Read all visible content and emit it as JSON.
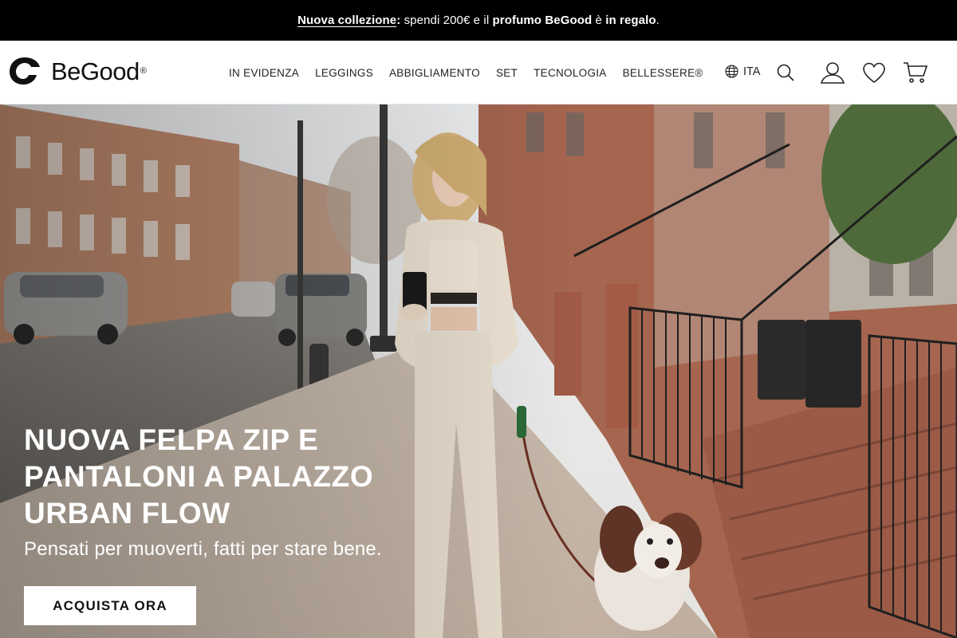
{
  "announcement": {
    "link_text": "Nuova collezione",
    "colon": ":",
    "text_before": " spendi 200€ e il ",
    "bold_product": "profumo BeGood",
    "text_middle": " è ",
    "bold_gift": "in regalo",
    "text_end": "."
  },
  "header": {
    "brand_name": "BeGood",
    "brand_mark": "®",
    "nav": [
      "IN EVIDENZA",
      "LEGGINGS",
      "ABBIGLIAMENTO",
      "SET",
      "TECNOLOGIA",
      "BELLESSERE®"
    ],
    "language": "ITA",
    "icons": [
      "globe-icon",
      "search-icon",
      "user-icon",
      "heart-icon",
      "cart-icon"
    ]
  },
  "hero": {
    "title": "NUOVA FELPA ZIP E PANTALONI A PALAZZO URBAN FLOW",
    "subtitle": "Pensati per muoverti, fatti per stare bene.",
    "cta_label": "ACQUISTA ORA"
  },
  "colors": {
    "announcement_bg": "#000000",
    "header_bg": "#ffffff",
    "text": "#111111",
    "cta_bg": "#ffffff"
  }
}
